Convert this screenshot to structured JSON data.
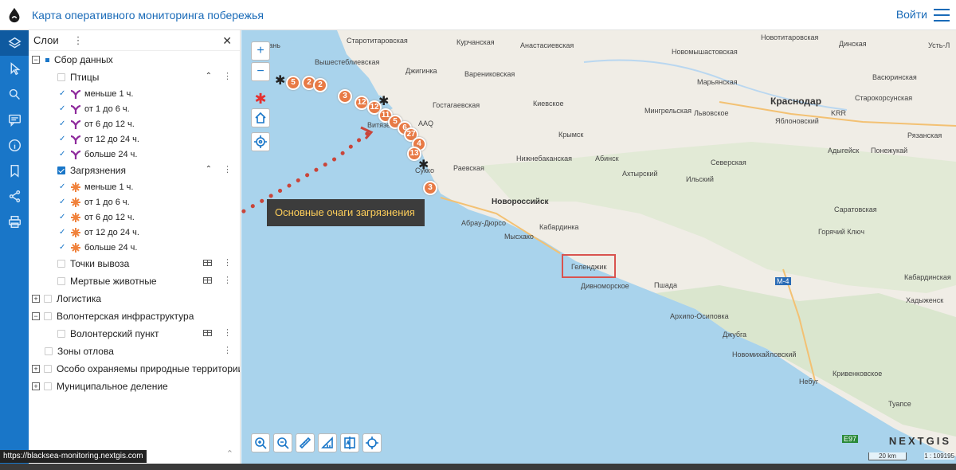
{
  "header": {
    "title": "Карта оперативного мониторинга побережья",
    "login": "Войти"
  },
  "panel": {
    "title": "Слои",
    "tree": [
      {
        "label": "Сбор данных"
      },
      {
        "label": "Птицы"
      },
      {
        "label": "меньше 1 ч."
      },
      {
        "label": "от 1 до 6 ч."
      },
      {
        "label": "от 6 до 12 ч."
      },
      {
        "label": "от 12 до 24 ч."
      },
      {
        "label": "больше 24 ч."
      },
      {
        "label": "Загрязнения"
      },
      {
        "label": "меньше 1 ч."
      },
      {
        "label": "от 1 до 6 ч."
      },
      {
        "label": "от 6 до 12 ч."
      },
      {
        "label": "от 12 до 24 ч."
      },
      {
        "label": "больше 24 ч."
      },
      {
        "label": "Точки вывоза"
      },
      {
        "label": "Мертвые животные"
      },
      {
        "label": "Логистика"
      },
      {
        "label": "Волонтерская инфраструктура"
      },
      {
        "label": "Волонтерский пункт"
      },
      {
        "label": "Зоны отлова"
      },
      {
        "label": "Особо охраняемы природные территории"
      },
      {
        "label": "Муниципальное деление"
      }
    ]
  },
  "status_url": "https://blacksea-monitoring.nextgis.com",
  "map": {
    "tooltip": "Основные очаги загрязнения",
    "brand": "NEXTGIS",
    "scale": "20 km",
    "scale_ratio": "1 : 109195",
    "places": [
      "Тамань",
      "Старотитаровская",
      "Курчанская",
      "Анастасиевская",
      "Новотитаровская",
      "Динская",
      "Усть-Л",
      "Вышестеблиевская",
      "Новомышастовская",
      "Джигинка",
      "Варениковская",
      "Васюринская",
      "Марьянская",
      "Краснодар",
      "Старокорсунская",
      "Киевское",
      "Гостагаевская",
      "Мингрельская",
      "Львовское",
      "Яблоновский",
      "KRR",
      "AAQ",
      "Витязево",
      "Крымск",
      "Адыгейск",
      "Понежукай",
      "Рязанская",
      "Нижнебаканская",
      "Абинск",
      "Северская",
      "Ахтырский",
      "Ильский",
      "Раевская",
      "Сукко",
      "Новороссийск",
      "Абрау-Дюрсо",
      "Мысхако",
      "Кабардинка",
      "Геленджик",
      "Дивноморское",
      "Пшада",
      "Горячий Ключ",
      "Саратовская",
      "Кабардинская",
      "Хадыженск",
      "Архипо-Осиповка",
      "Джубга",
      "Новомихайловский",
      "Небуг",
      "Кривенковское",
      "Туапсе",
      "М-4",
      "E97"
    ],
    "markers": [
      "5",
      "2",
      "2",
      "3",
      "12",
      "12",
      "11",
      "5",
      "6",
      "27",
      "4",
      "13",
      "3"
    ],
    "colors": {
      "marker": "#e87a45",
      "toolbar": "#1976c8",
      "sea": "#a9d3ec"
    }
  }
}
